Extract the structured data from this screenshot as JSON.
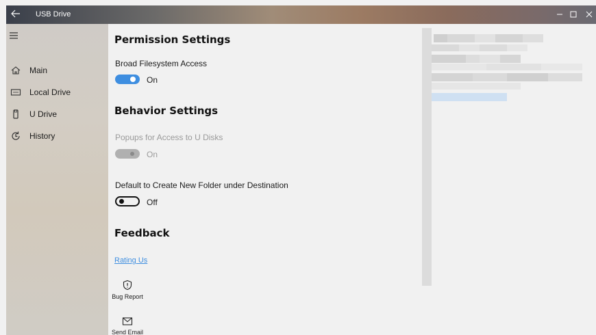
{
  "window": {
    "title": "USB Drive",
    "back_icon": "back-arrow-icon",
    "minimize_icon": "minimize-icon",
    "maximize_icon": "maximize-icon",
    "close_icon": "close-icon"
  },
  "sidebar": {
    "menu_icon": "hamburger-icon",
    "items": [
      {
        "label": "Main",
        "icon": "home-icon"
      },
      {
        "label": "Local Drive",
        "icon": "drive-icon"
      },
      {
        "label": "U Drive",
        "icon": "usb-icon"
      },
      {
        "label": "History",
        "icon": "history-icon"
      }
    ]
  },
  "permission": {
    "heading": "Permission Settings",
    "broad_access": {
      "label": "Broad Filesystem Access",
      "state": "On"
    }
  },
  "behavior": {
    "heading": "Behavior Settings",
    "popups": {
      "label": "Popups for Access to U Disks",
      "state": "On"
    },
    "new_folder": {
      "label": "Default to Create New Folder under Destination",
      "state": "Off"
    }
  },
  "feedback": {
    "heading": "Feedback",
    "rating_link": "Rating Us",
    "bug_report": "Bug Report",
    "send_email": "Send Email"
  },
  "colors": {
    "accent": "#3e8ee0",
    "disabled": "#b0b0b0",
    "background": "#f1f1f1"
  }
}
